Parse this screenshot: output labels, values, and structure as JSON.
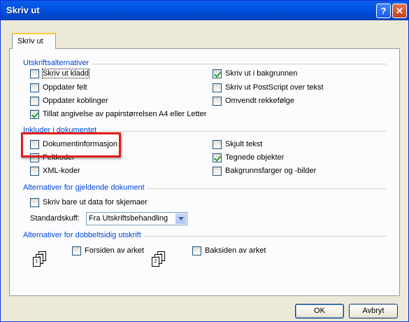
{
  "window": {
    "title": "Skriv ut",
    "help_label": "?",
    "close_label": "✕"
  },
  "tab": {
    "label": "Skriv ut"
  },
  "groups": {
    "print_options": {
      "title": "Utskriftsalternativer",
      "left": [
        {
          "label": "Skriv ut kladd",
          "checked": false
        },
        {
          "label": "Oppdater felt",
          "checked": false
        },
        {
          "label": "Oppdater koblinger",
          "checked": false
        },
        {
          "label": "Tillat angivelse av papirstørrelsen A4 eller Letter",
          "checked": true
        }
      ],
      "right": [
        {
          "label": "Skriv ut i bakgrunnen",
          "checked": true
        },
        {
          "label": "Skriv ut PostScript over tekst",
          "checked": false
        },
        {
          "label": "Omvendt rekkefølge",
          "checked": false
        }
      ]
    },
    "include": {
      "title": "Inkluder i dokumentet",
      "left": [
        {
          "label": "Dokumentinformasjon",
          "checked": false
        },
        {
          "label": "Feltkoder",
          "checked": false
        },
        {
          "label": "XML-koder",
          "checked": false
        }
      ],
      "right": [
        {
          "label": "Skjult tekst",
          "checked": false
        },
        {
          "label": "Tegnede objekter",
          "checked": true
        },
        {
          "label": "Bakgrunnsfarger og -bilder",
          "checked": false
        }
      ]
    },
    "current_doc": {
      "title": "Alternativer for gjeldende dokument",
      "form_data": {
        "label": "Skriv bare ut data for skjemaer",
        "checked": false
      },
      "tray_label": "Standardskuff:",
      "tray_value": "Fra Utskriftsbehandling"
    },
    "duplex": {
      "title": "Alternativer for dobbeltsidig utskrift",
      "front": {
        "label": "Forsiden av arket",
        "checked": false
      },
      "back": {
        "label": "Baksiden av arket",
        "checked": false
      },
      "front_pages": [
        "1",
        "3",
        "5"
      ],
      "back_pages": [
        "2",
        "4",
        "6"
      ]
    }
  },
  "buttons": {
    "ok": "OK",
    "cancel": "Avbryt"
  },
  "colors": {
    "group_title": "#0046d5",
    "highlight": "#e21b1b",
    "titlebar": "#0054e3"
  }
}
